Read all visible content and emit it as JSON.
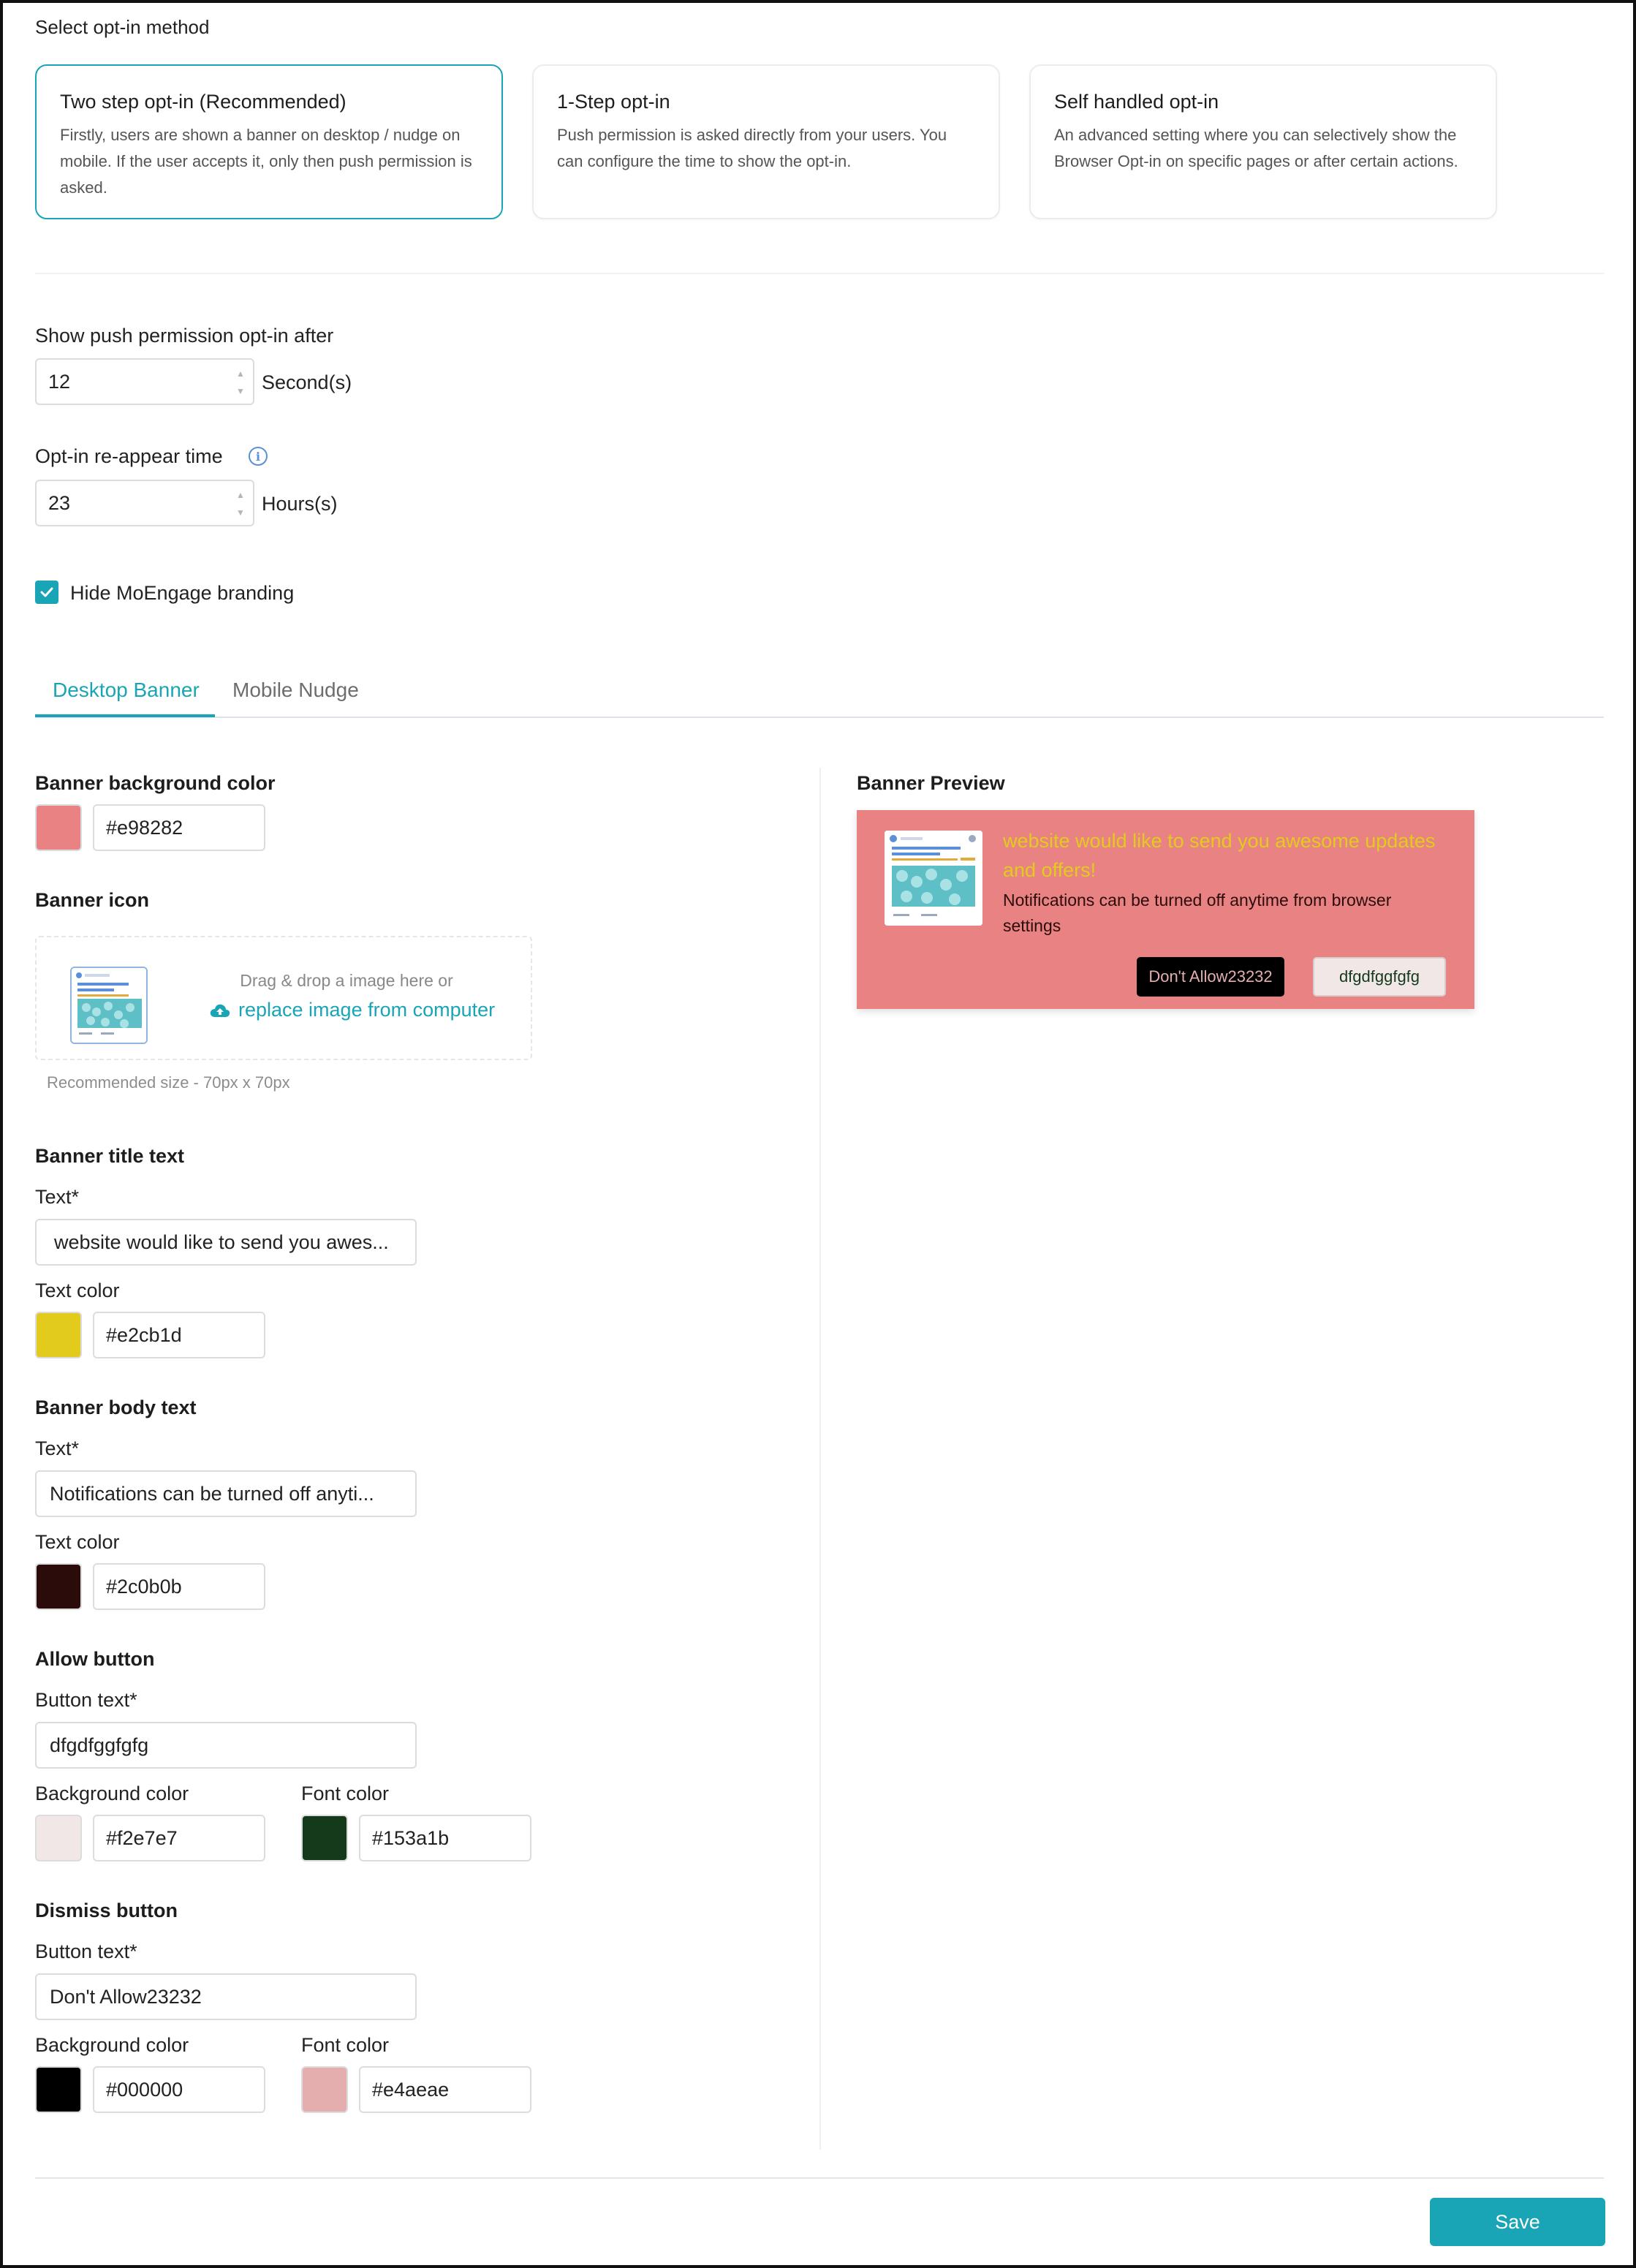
{
  "optin": {
    "section_title": "Select opt-in method",
    "methods": [
      {
        "title": "Two step opt-in (Recommended)",
        "desc": "Firstly, users are shown a banner on desktop / nudge on mobile. If the user accepts it, only then push permission is asked.",
        "selected": true
      },
      {
        "title": "1-Step opt-in",
        "desc": "Push permission is asked directly from your users. You can configure the time to show the opt-in.",
        "selected": false
      },
      {
        "title": "Self handled opt-in",
        "desc": "An advanced setting where you can selectively show the Browser Opt-in on specific pages or after certain actions.",
        "selected": false
      }
    ]
  },
  "timing": {
    "show_after_label": "Show push permission opt-in after",
    "show_after_value": "12",
    "show_after_unit": "Second(s)",
    "reappear_label": "Opt-in re-appear time",
    "reappear_value": "23",
    "reappear_unit": "Hours(s)"
  },
  "branding": {
    "label": "Hide MoEngage branding",
    "checked": true
  },
  "tabs": [
    {
      "label": "Desktop Banner",
      "active": true
    },
    {
      "label": "Mobile Nudge",
      "active": false
    }
  ],
  "form": {
    "bg_color_label": "Banner background color",
    "bg_color_value": "#e98282",
    "icon_label": "Banner icon",
    "drop_hint": "Drag & drop a image here or",
    "drop_link": "replace image from computer",
    "recommended_size": "Recommended size - 70px x 70px",
    "title_section": "Banner title text",
    "title_text_label": "Text*",
    "title_text_value": "website would like to send you awes...",
    "title_color_label": "Text color",
    "title_color_value": "#e2cb1d",
    "body_section": "Banner body text",
    "body_text_label": "Text*",
    "body_text_value": "Notifications can be turned off anyti...",
    "body_color_label": "Text color",
    "body_color_value": "#2c0b0b",
    "allow_section": "Allow button",
    "allow_text_label": "Button text*",
    "allow_text_value": "dfgdfggfgfg",
    "allow_bg_label": "Background color",
    "allow_bg_value": "#f2e7e7",
    "allow_font_label": "Font color",
    "allow_font_value": "#153a1b",
    "dismiss_section": "Dismiss button",
    "dismiss_text_label": "Button text*",
    "dismiss_text_value": "Don't Allow23232",
    "dismiss_bg_label": "Background color",
    "dismiss_bg_value": "#000000",
    "dismiss_font_label": "Font color",
    "dismiss_font_value": "#e4aeae"
  },
  "preview": {
    "label": "Banner Preview",
    "title": "website would like to send you awesome updates and offers!",
    "body": "Notifications can be turned off anytime from browser settings",
    "dismiss": "Don't Allow23232",
    "allow": "dfgdfggfgfg"
  },
  "actions": {
    "save": "Save"
  },
  "colors": {
    "accent": "#1aa5b6",
    "banner_bg": "#e98282",
    "title_color": "#e2cb1d",
    "body_color": "#2c0b0b",
    "allow_bg": "#f2e7e7",
    "allow_font": "#153a1b",
    "dismiss_bg": "#000000",
    "dismiss_font": "#e4aeae"
  },
  "icons": {
    "info": "info-icon",
    "check": "check-icon",
    "upload": "cloud-upload-icon",
    "spinner": "number-spinner-icon"
  }
}
